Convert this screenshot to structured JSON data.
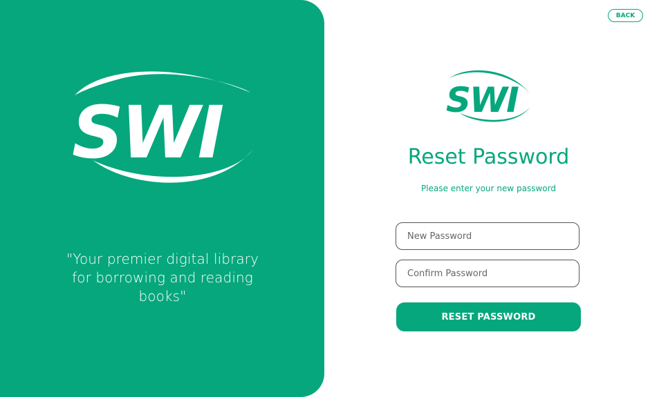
{
  "brand": {
    "logo_text": "SWI",
    "accent_color": "#06a77d"
  },
  "left_panel": {
    "tagline": "\"Your premier digital library for borrowing and reading books\""
  },
  "header": {
    "back_label": "BACK"
  },
  "form": {
    "title": "Reset Password",
    "subtitle": "Please enter your new password",
    "new_password_placeholder": "New Password",
    "new_password_value": "",
    "confirm_password_placeholder": "Confirm Password",
    "confirm_password_value": "",
    "submit_label": "RESET PASSWORD"
  }
}
